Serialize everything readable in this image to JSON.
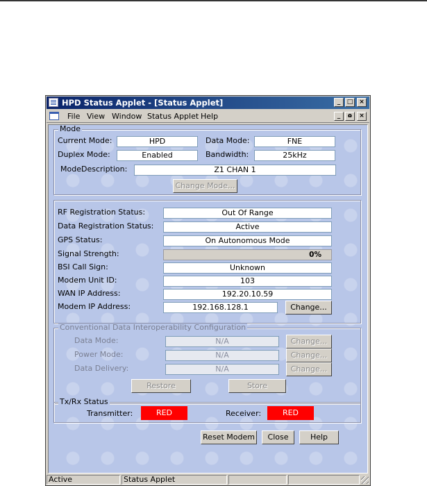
{
  "window": {
    "title": "HPD Status Applet - [Status Applet]",
    "controls": {
      "minimize": "_",
      "maximize": "□",
      "close": "×",
      "restore": "ɷ"
    }
  },
  "menu": [
    "File",
    "View",
    "Window",
    "Status Applet",
    "Help"
  ],
  "mode": {
    "legend": "Mode",
    "current_mode_label": "Current Mode:",
    "current_mode": "HPD",
    "data_mode_label": "Data Mode:",
    "data_mode": "FNE",
    "duplex_mode_label": "Duplex Mode:",
    "duplex_mode": "Enabled",
    "bandwidth_label": "Bandwidth:",
    "bandwidth": "25kHz",
    "description_label": "ModeDescription:",
    "description": "Z1  CHAN 1",
    "change_mode_button": "Change Mode..."
  },
  "status": {
    "rf_registration_label": "RF Registration Status:",
    "rf_registration": "Out Of Range",
    "data_registration_label": "Data Registration Status:",
    "data_registration": "Active",
    "gps_label": "GPS Status:",
    "gps": "On Autonomous Mode",
    "signal_label": "Signal Strength:",
    "signal_text": "0%",
    "signal_fraction": 0,
    "bsi_label": "BSI Call Sign:",
    "bsi": "Unknown",
    "modem_unit_label": "Modem Unit ID:",
    "modem_unit": "103",
    "wan_ip_label": "WAN IP Address:",
    "wan_ip": "192.20.10.59",
    "modem_ip_label": "Modem IP Address:",
    "modem_ip": "192.168.128.1",
    "change_button": "Change..."
  },
  "conventional": {
    "legend": "Conventional Data Interoperability Configuration",
    "data_mode_label": "Data Mode:",
    "data_mode": "N/A",
    "power_mode_label": "Power Mode:",
    "power_mode": "N/A",
    "data_delivery_label": "Data Delivery:",
    "data_delivery": "N/A",
    "change_button": "Change...",
    "restore_button": "Restore",
    "store_button": "Store"
  },
  "txrx": {
    "legend": "Tx/Rx Status",
    "transmitter_label": "Transmitter:",
    "transmitter": "RED",
    "receiver_label": "Receiver:",
    "receiver": "RED",
    "indicator_color": "#ff0000"
  },
  "buttons": {
    "reset_modem": "Reset Modem",
    "close": "Close",
    "help": "Help"
  },
  "statusbar": {
    "left": "Active",
    "middle": "Status Applet"
  }
}
